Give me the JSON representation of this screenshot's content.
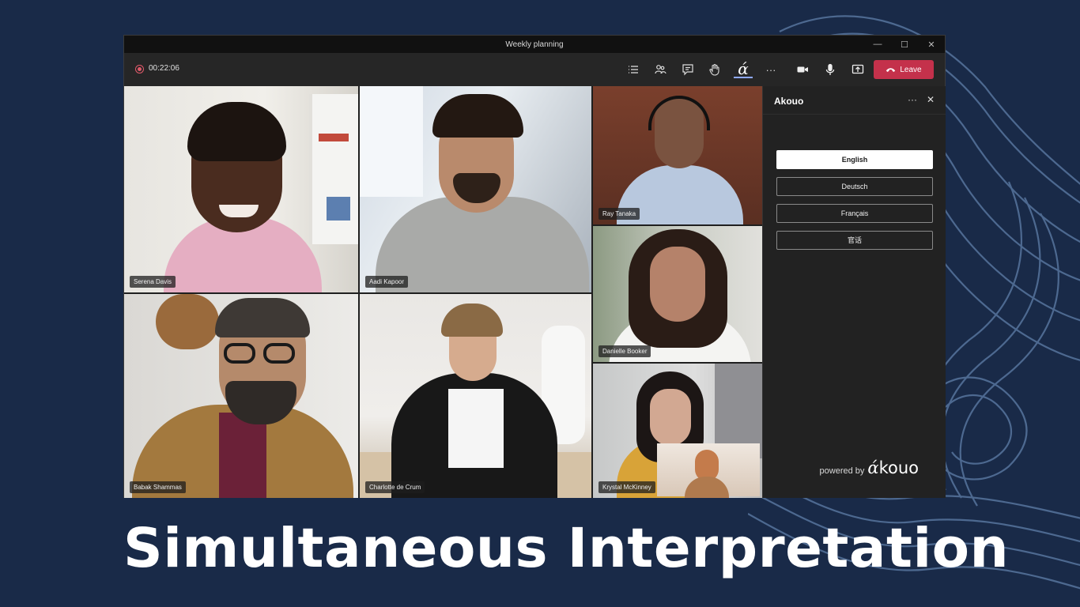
{
  "window": {
    "title": "Weekly planning",
    "controls": {
      "minimize": "—",
      "maximize": "☐",
      "close": "✕"
    }
  },
  "toolbar": {
    "timer": "00:22:06",
    "icons": [
      "list-icon",
      "people-icon",
      "chat-icon",
      "raise-hand-icon",
      "akouo-icon",
      "more-icon",
      "camera-icon",
      "mic-icon",
      "share-icon"
    ],
    "akouo_glyph": "ά",
    "more_glyph": "···",
    "leave_label": "Leave",
    "leave_color": "#c4314b"
  },
  "participants": [
    {
      "name": "Serena Davis"
    },
    {
      "name": "Aadi Kapoor"
    },
    {
      "name": "Ray Tanaka"
    },
    {
      "name": "Danielle Booker"
    },
    {
      "name": "Babak Shammas"
    },
    {
      "name": "Charlotte de Crum"
    },
    {
      "name": "Krystal McKinney"
    }
  ],
  "panel": {
    "title": "Akouo",
    "more": "···",
    "close": "✕",
    "languages": [
      "English",
      "Deutsch",
      "Français",
      "官话"
    ],
    "selected_language": "English",
    "powered_by": "powered by",
    "brand_alpha": "ά",
    "brand_rest": "kouo"
  },
  "headline": "Simultaneous Interpretation",
  "colors": {
    "background": "#192a48",
    "accent": "#8ea8ff"
  }
}
